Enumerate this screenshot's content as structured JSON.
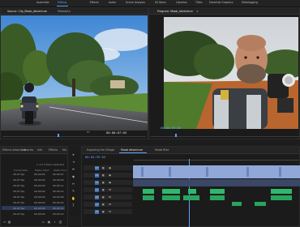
{
  "nav": {
    "items": [
      "Assemble",
      "Editing",
      "Effects",
      "Audio",
      "Scene Analysis",
      "All Items",
      "Libraries",
      "Titles",
      "Essential Graphics",
      "Metalogging"
    ],
    "active_index": 1
  },
  "source_panel": {
    "tabs": [
      "Source: Clip_Moab_Adventure",
      "Metadata"
    ],
    "fit_label": "Fit",
    "timecode": "00:00:07:03"
  },
  "program_panel": {
    "tabs": [
      "Program: Moab_Adventure",
      "≡"
    ],
    "timecode": "00:04:59:03",
    "fit_label": "Fit"
  },
  "project_panel": {
    "tabs": [
      "Effects Adventure",
      "Libraries",
      "Info",
      "Effects",
      "Ma"
    ],
    "item_count": "1 of 17 Items Selected",
    "columns": [
      "Frame Rate",
      "Media Start",
      "Media End"
    ],
    "rows": [
      [
        "29.97 fps",
        "00:00:00",
        "00:00:07"
      ],
      [
        "29.97 fps",
        "00:00:00",
        "00:00:09"
      ],
      [
        "29.97 fps",
        "00:00:00",
        "00:00:11"
      ],
      [
        "29.97 fps",
        "00:00:00",
        "00:00:14"
      ],
      [
        "29.97 fps",
        "00:00:00",
        "00:00:06"
      ],
      [
        "29.97 fps",
        "00:00:00",
        "00:00:04"
      ],
      [
        "29.97 fps",
        "00:00:00",
        "00:00:10"
      ],
      [
        "29.97 fps",
        "00:00:00",
        "00:00:12"
      ]
    ]
  },
  "timeline": {
    "tabs": [
      "Exploring the Village",
      "Moab Adventure",
      "Moab Ride"
    ],
    "timecode": "00:04:59:03",
    "tracks": [
      "V3",
      "V2",
      "V1",
      "A1",
      "A2",
      "A3",
      "A4"
    ]
  },
  "colors": {
    "accent": "#5ea1ff",
    "video_clip": "#8fa8d8",
    "audio_clip": "#2fb86b",
    "timecode": "#6aa5ff"
  }
}
